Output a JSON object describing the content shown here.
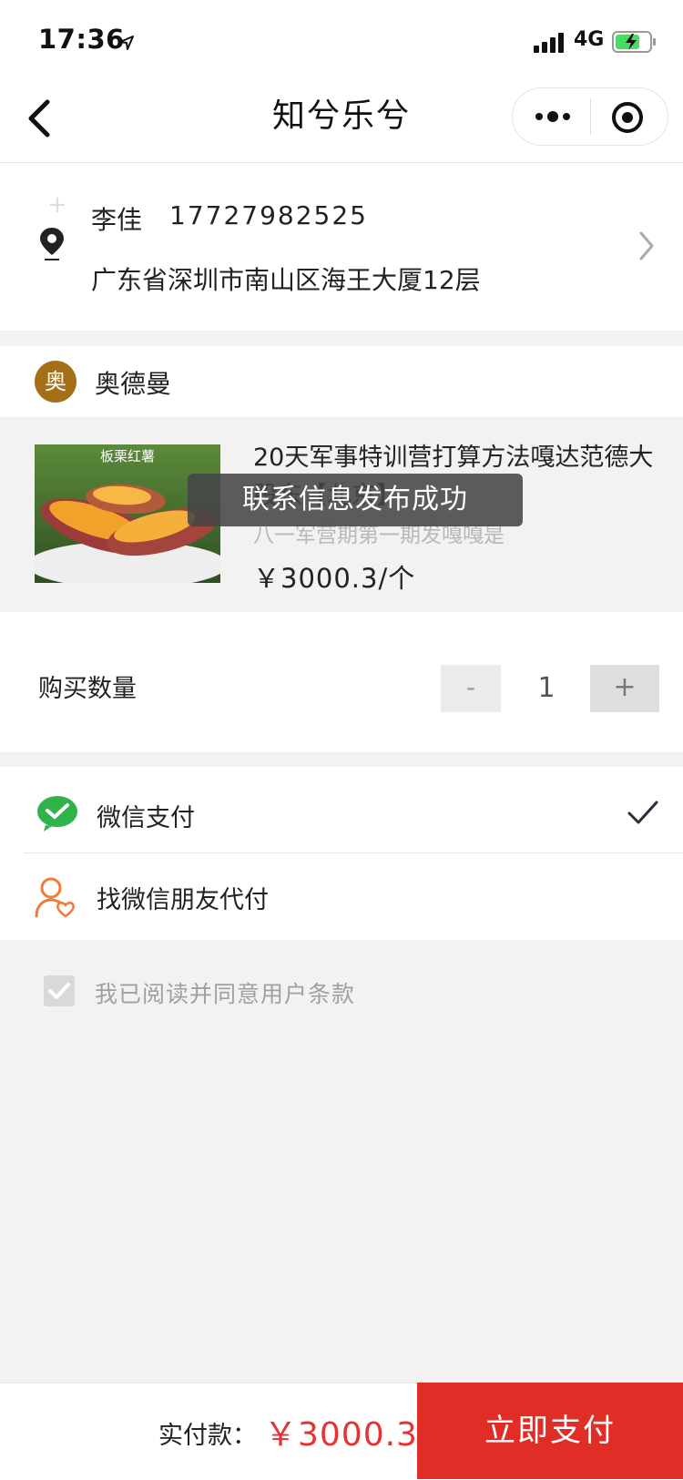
{
  "status_bar": {
    "time": "17:36",
    "network": "4G"
  },
  "nav": {
    "title": "知兮乐兮",
    "icons": [
      "back-icon",
      "more-icon",
      "target-icon"
    ]
  },
  "address": {
    "name": "李佳",
    "phone": "17727982525",
    "line": "广东省深圳市南山区海王大厦12层",
    "plus_mark": "+"
  },
  "shop": {
    "avatar_char": "奥",
    "name": "奥德曼"
  },
  "product": {
    "image_caption": "板栗红薯",
    "title": "20天军事特训营打算方法嘎达范德大股东【北京】",
    "subtitle": "八一军营期第一期发嘎嘎是",
    "price": "￥3000.3/个"
  },
  "toast": {
    "text": "联系信息发布成功"
  },
  "quantity": {
    "label": "购买数量",
    "minus": "-",
    "value": "1",
    "plus": "+"
  },
  "payment": {
    "wechat_label": "微信支付",
    "wechat_selected": true,
    "friend_label": "找微信朋友代付"
  },
  "agreement": {
    "label": "我已阅读并同意用户条款",
    "checked": true
  },
  "footer": {
    "paid_label": "实付款：",
    "paid_amount": "￥3000.3",
    "pay_button": "立即支付"
  },
  "colors": {
    "accent_red": "#e02e26",
    "price_red": "#e53232",
    "wechat_green": "#2fb34a",
    "friend_orange": "#f07a3a",
    "avatar_brown": "#a56f18"
  }
}
